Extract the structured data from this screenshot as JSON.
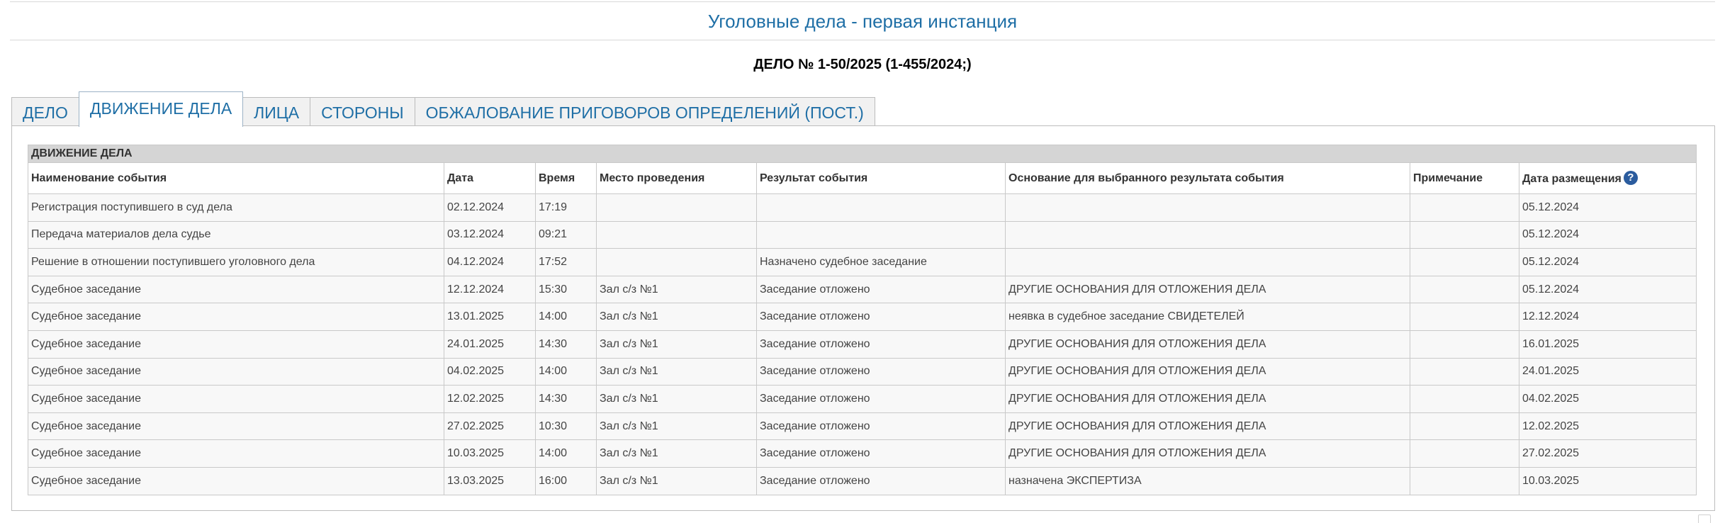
{
  "page_title": "Уголовные дела - первая инстанция",
  "case_number": "ДЕЛО № 1-50/2025 (1-455/2024;)",
  "tabs": [
    {
      "label": "ДЕЛО"
    },
    {
      "label": "ДВИЖЕНИЕ ДЕЛА",
      "active": true
    },
    {
      "label": "ЛИЦА"
    },
    {
      "label": "СТОРОНЫ"
    },
    {
      "label": "ОБЖАЛОВАНИЕ ПРИГОВОРОВ ОПРЕДЕЛЕНИЙ (ПОСТ.)"
    }
  ],
  "movement": {
    "section_title": "ДВИЖЕНИЕ ДЕЛА",
    "columns": [
      "Наименование события",
      "Дата",
      "Время",
      "Место проведения",
      "Результат события",
      "Основание для выбранного результата события",
      "Примечание",
      "Дата размещения"
    ],
    "help_icon": "?",
    "rows": [
      [
        "Регистрация поступившего в суд дела",
        "02.12.2024",
        "17:19",
        "",
        "",
        "",
        "",
        "05.12.2024"
      ],
      [
        "Передача материалов дела судье",
        "03.12.2024",
        "09:21",
        "",
        "",
        "",
        "",
        "05.12.2024"
      ],
      [
        "Решение в отношении поступившего уголовного дела",
        "04.12.2024",
        "17:52",
        "",
        "Назначено судебное заседание",
        "",
        "",
        "05.12.2024"
      ],
      [
        "Судебное заседание",
        "12.12.2024",
        "15:30",
        "Зал с/з №1",
        "Заседание отложено",
        "ДРУГИЕ ОСНОВАНИЯ ДЛЯ ОТЛОЖЕНИЯ ДЕЛА",
        "",
        "05.12.2024"
      ],
      [
        "Судебное заседание",
        "13.01.2025",
        "14:00",
        "Зал с/з №1",
        "Заседание отложено",
        "неявка в судебное заседание СВИДЕТЕЛЕЙ",
        "",
        "12.12.2024"
      ],
      [
        "Судебное заседание",
        "24.01.2025",
        "14:30",
        "Зал с/з №1",
        "Заседание отложено",
        "ДРУГИЕ ОСНОВАНИЯ ДЛЯ ОТЛОЖЕНИЯ ДЕЛА",
        "",
        "16.01.2025"
      ],
      [
        "Судебное заседание",
        "04.02.2025",
        "14:00",
        "Зал с/з №1",
        "Заседание отложено",
        "ДРУГИЕ ОСНОВАНИЯ ДЛЯ ОТЛОЖЕНИЯ ДЕЛА",
        "",
        "24.01.2025"
      ],
      [
        "Судебное заседание",
        "12.02.2025",
        "14:30",
        "Зал с/з №1",
        "Заседание отложено",
        "ДРУГИЕ ОСНОВАНИЯ ДЛЯ ОТЛОЖЕНИЯ ДЕЛА",
        "",
        "04.02.2025"
      ],
      [
        "Судебное заседание",
        "27.02.2025",
        "10:30",
        "Зал с/з №1",
        "Заседание отложено",
        "ДРУГИЕ ОСНОВАНИЯ ДЛЯ ОТЛОЖЕНИЯ ДЕЛА",
        "",
        "12.02.2025"
      ],
      [
        "Судебное заседание",
        "10.03.2025",
        "14:00",
        "Зал с/з №1",
        "Заседание отложено",
        "ДРУГИЕ ОСНОВАНИЯ ДЛЯ ОТЛОЖЕНИЯ ДЕЛА",
        "",
        "27.02.2025"
      ],
      [
        "Судебное заседание",
        "13.03.2025",
        "16:00",
        "Зал с/з №1",
        "Заседание отложено",
        "назначена ЭКСПЕРТИЗА",
        "",
        "10.03.2025"
      ]
    ]
  }
}
